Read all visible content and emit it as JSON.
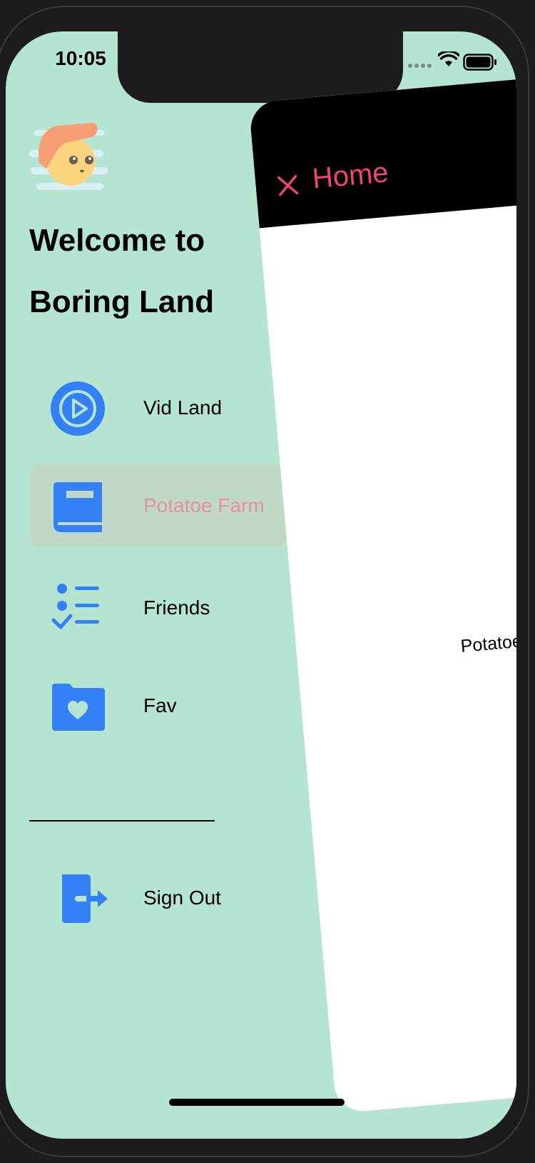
{
  "status_bar": {
    "time": "10:05"
  },
  "drawer": {
    "welcome_line1": "Welcome to",
    "welcome_line2": "Boring Land",
    "items": [
      {
        "label": "Vid Land",
        "icon": "play-circle-icon",
        "active": false
      },
      {
        "label": "Potatoe Farm",
        "icon": "book-icon",
        "active": true
      },
      {
        "label": "Friends",
        "icon": "checklist-icon",
        "active": false
      },
      {
        "label": "Fav",
        "icon": "folder-heart-icon",
        "active": false
      }
    ],
    "sign_out": {
      "label": "Sign Out",
      "icon": "sign-out-icon"
    }
  },
  "home_card": {
    "title": "Home",
    "body_text": "Potatoe Farm"
  },
  "colors": {
    "drawer_background": "#b5e4d1",
    "active_item_background": "#bfd8c8",
    "active_item_text": "#e8919a",
    "icon_blue": "#3480f5",
    "header_accent": "#f0466e"
  }
}
